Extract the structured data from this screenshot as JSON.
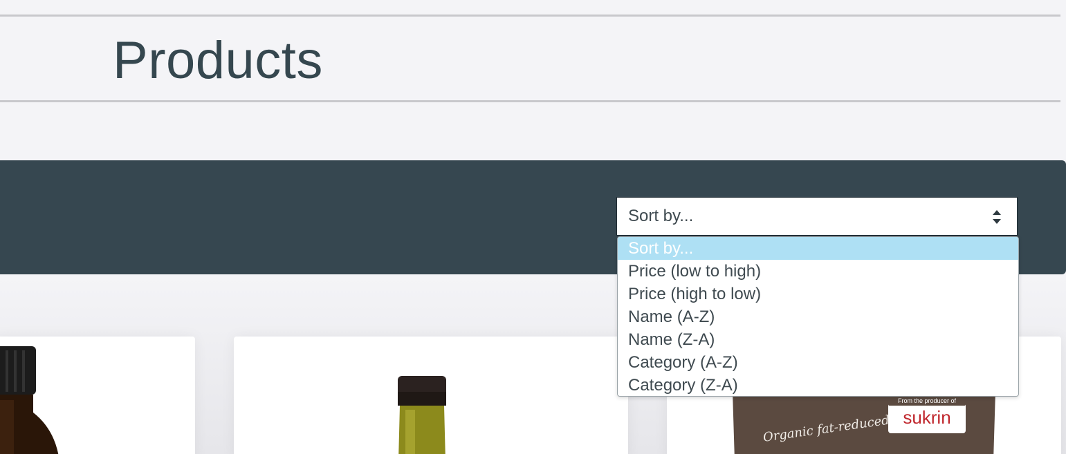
{
  "page": {
    "title": "Products"
  },
  "sort": {
    "current": "Sort by...",
    "options": [
      "Sort by...",
      "Price (low to high)",
      "Price (high to low)",
      "Name (A-Z)",
      "Name (Z-A)",
      "Category (A-Z)",
      "Category (Z-A)"
    ],
    "highlighted_index": 0
  },
  "products": [
    {
      "image": "amber-bottle-image"
    },
    {
      "image": "olive-oil-bottle-image"
    },
    {
      "image": "sukrin-bag-image",
      "brand_tag": "From the producer of",
      "brand": "sukrin",
      "package_text": "Organic fat-reduced"
    }
  ],
  "colors": {
    "filter_bar": "#364750",
    "highlight": "#aee0f4",
    "title": "#35474f",
    "page_bg": "#f4f4f7"
  }
}
